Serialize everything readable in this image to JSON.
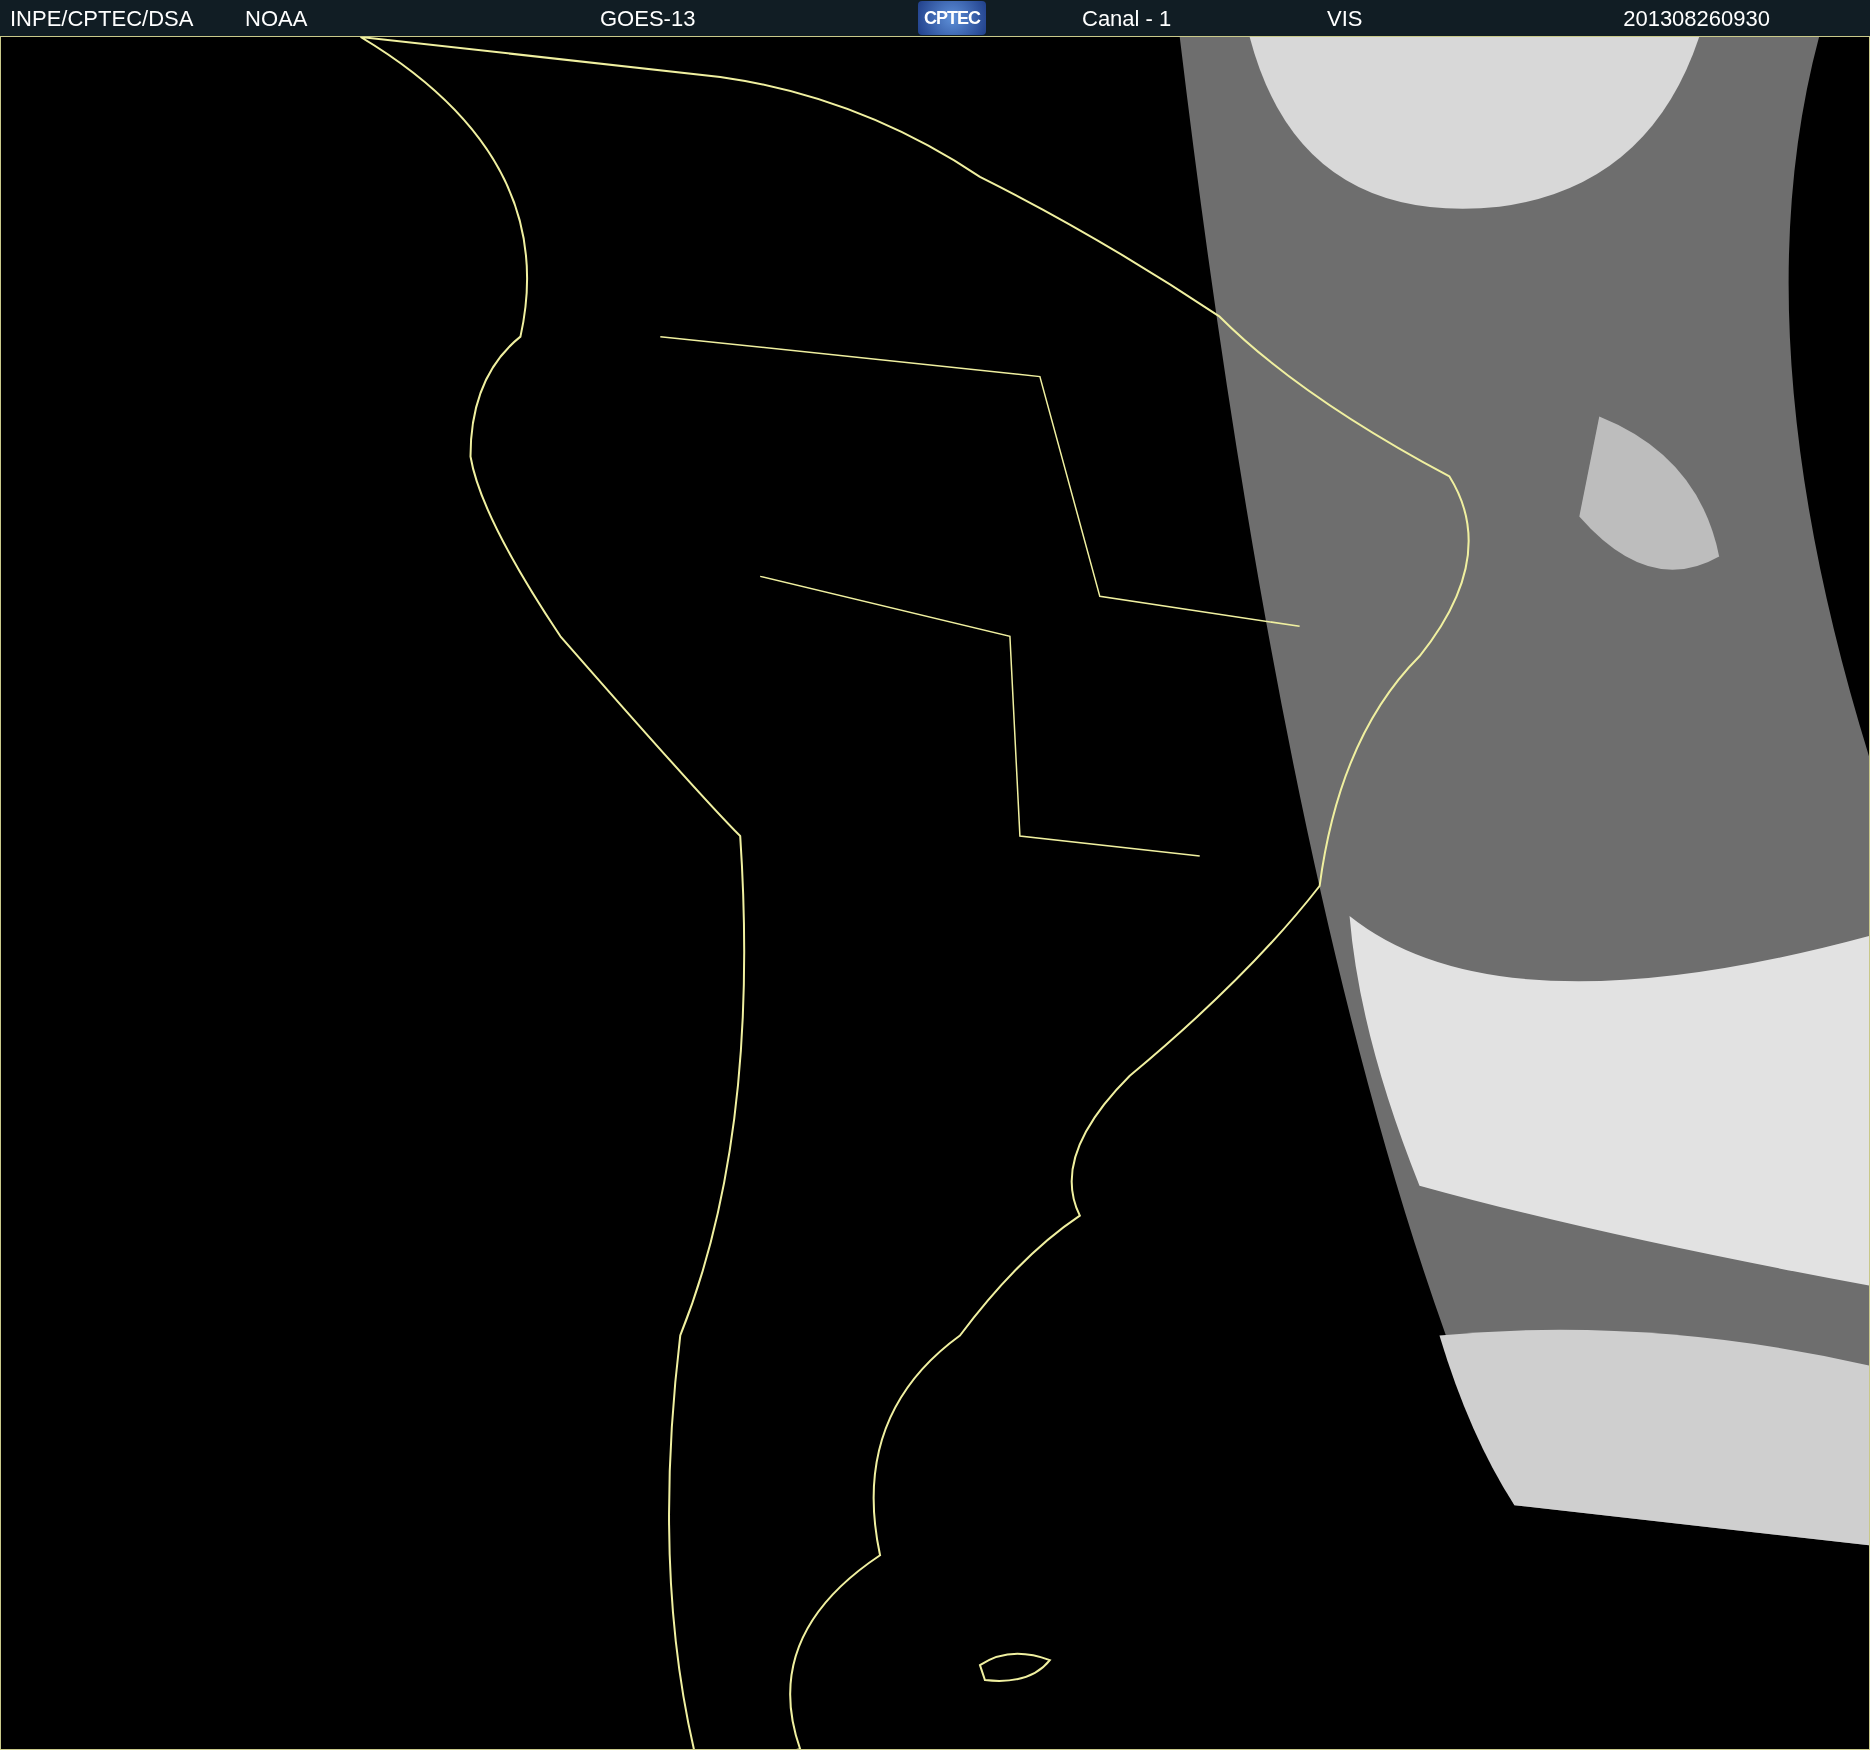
{
  "header": {
    "items": [
      {
        "kind": "text",
        "text": "INPE/CPTEC/DSA"
      },
      {
        "kind": "text",
        "text": "NOAA"
      },
      {
        "kind": "text",
        "text": "GOES-13"
      },
      {
        "kind": "logo",
        "text": "CPTEC"
      },
      {
        "kind": "text",
        "text": "Canal - 1"
      },
      {
        "kind": "text",
        "text": "VIS"
      },
      {
        "kind": "text",
        "text": "201308260930"
      }
    ]
  }
}
